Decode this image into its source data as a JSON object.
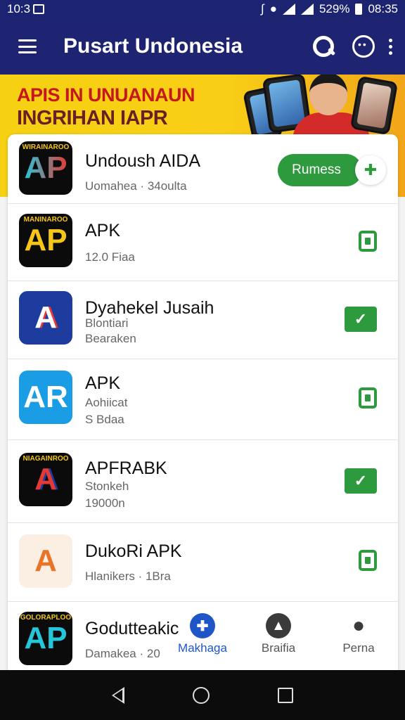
{
  "status_bar": {
    "time": "10:3",
    "battery": "529%",
    "clock": "08:35"
  },
  "app_bar": {
    "title": "Pusart Undonesia"
  },
  "banner": {
    "line1": "APIS IN UNUANAUN",
    "line2": "INGRIHAN IAPR"
  },
  "apps": [
    {
      "name": "Undoush AIDA",
      "sub1": "Uomahea  ·  34oulta",
      "sub2": "",
      "logo_text": "AP",
      "logo_tag": "WIRAINAROO",
      "action": "pill",
      "action_label": "Rumess"
    },
    {
      "name": "APK",
      "sub1": "12.0 Fiaa",
      "sub2": "",
      "logo_text": "AP",
      "logo_tag": "MANINAROO",
      "action": "small"
    },
    {
      "name": "Dyahekel Jusaih",
      "sub1": "Blontiari",
      "sub2": "Bearaken",
      "logo_text": "A",
      "logo_tag": "",
      "action": "big"
    },
    {
      "name": "APK",
      "sub1": "Aohiicat",
      "sub2": "S Bdaa",
      "logo_text": "AR",
      "logo_tag": "",
      "action": "small"
    },
    {
      "name": "APFRABK",
      "sub1": "Stonkeh",
      "sub2": "19000n",
      "logo_text": "A",
      "logo_tag": "NIAGAINROO",
      "action": "big"
    },
    {
      "name": "DukoRi APK",
      "sub1": "Hlanikers  ·  1Bra",
      "sub2": "",
      "logo_text": "A",
      "logo_tag": "",
      "action": "small"
    },
    {
      "name": "Godutteakic",
      "sub1": "Damakea  ·  20",
      "sub2": "",
      "logo_text": "AP",
      "logo_tag": "GOLORAPLOO",
      "action": "none"
    }
  ],
  "bottom_nav": [
    {
      "label": "Makhaga",
      "icon": "plus-icon",
      "color": "#1e56c8"
    },
    {
      "label": "Braifia",
      "icon": "chart-icon",
      "color": "#3a3a3a"
    },
    {
      "label": "Perna",
      "icon": "person-icon",
      "color": "#3a3a3a"
    }
  ],
  "colors": {
    "primary": "#1e2472",
    "accent": "#2d9a3e",
    "banner": "#f6d012"
  }
}
